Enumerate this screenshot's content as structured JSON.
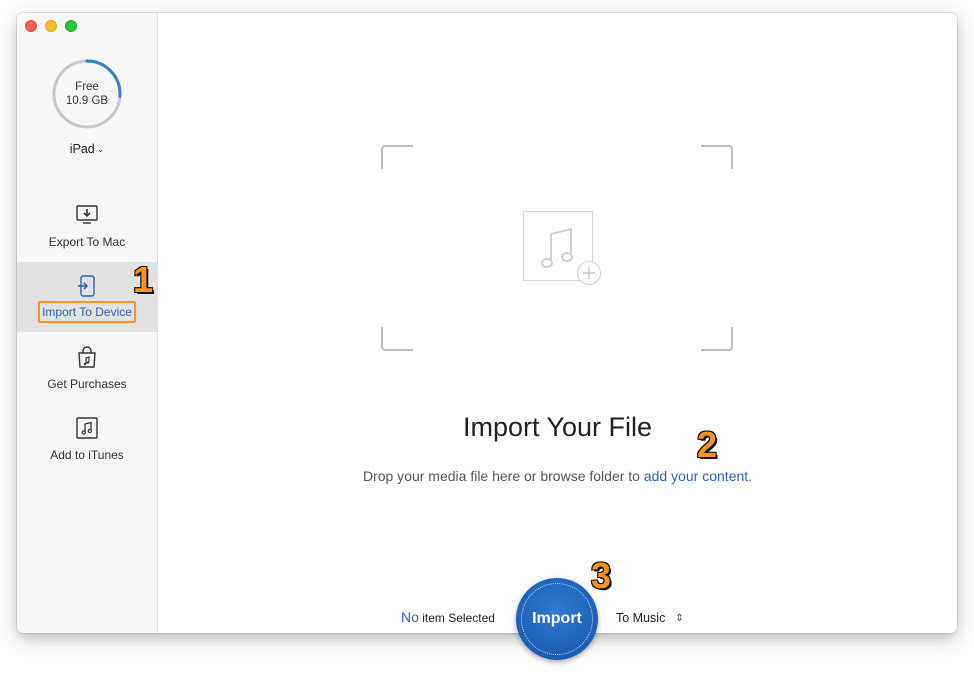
{
  "storage": {
    "label": "Free",
    "value": "10.9 GB",
    "fraction_used": 0.26
  },
  "device": {
    "name": "iPad",
    "chevron": "⌄"
  },
  "sidebar": {
    "items": [
      {
        "label": "Export To Mac",
        "icon": "export-to-mac-icon"
      },
      {
        "label": "Import To Device",
        "icon": "import-to-device-icon",
        "active": true
      },
      {
        "label": "Get Purchases",
        "icon": "shopping-bag-icon"
      },
      {
        "label": "Add to iTunes",
        "icon": "itunes-note-icon"
      }
    ]
  },
  "main": {
    "title": "Import Your File",
    "subtitle_prefix": "Drop your media file here or browse folder to ",
    "subtitle_link": "add your content",
    "subtitle_suffix": "."
  },
  "steps": {
    "one": "1",
    "two": "2",
    "three": "3"
  },
  "bottom": {
    "count": "No",
    "selected_text": " item Selected",
    "import_label": "Import",
    "destination": "To Music",
    "destination_arrows": "⌃⌄"
  },
  "colors": {
    "accent": "#2d62b8",
    "highlight": "#f7931e",
    "import_button": "#1b5fb4"
  }
}
